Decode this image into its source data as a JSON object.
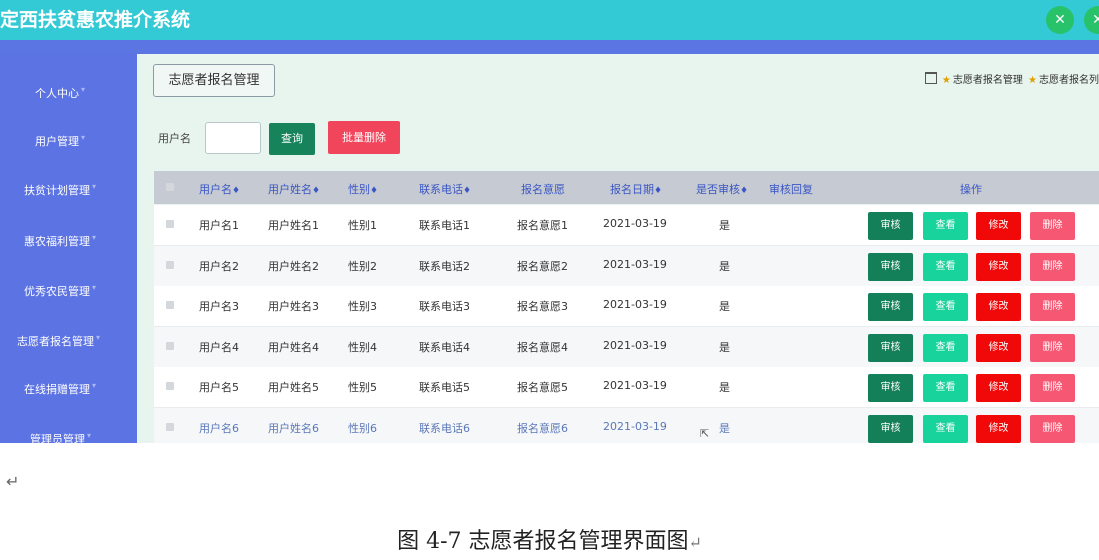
{
  "app_title": "定西扶贫惠农推介系统",
  "colors": {
    "topbar": "#33c9d5",
    "sidebar": "#5c73e3",
    "accent_green": "#16835a",
    "danger": "#f1455b"
  },
  "top_icons": [
    "expand-icon",
    "user-icon"
  ],
  "sidebar": {
    "items": [
      {
        "label": "个人中心"
      },
      {
        "label": "用户管理"
      },
      {
        "label": "扶贫计划管理"
      },
      {
        "label": "惠农福利管理"
      },
      {
        "label": "优秀农民管理"
      },
      {
        "label": "志愿者报名管理"
      },
      {
        "label": "在线捐赠管理"
      },
      {
        "label": "管理员管理"
      }
    ]
  },
  "page": {
    "section_button": "志愿者报名管理",
    "breadcrumb": {
      "first": "志愿者报名管理",
      "second": "志愿者报名列"
    }
  },
  "search": {
    "label": "用户名",
    "value": "",
    "query_button": "查询",
    "batch_delete_button": "批量删除"
  },
  "table": {
    "columns": {
      "username": "用户名",
      "realname": "用户姓名",
      "gender": "性别",
      "phone": "联系电话",
      "intention": "报名意愿",
      "date": "报名日期",
      "audited": "是否审核",
      "reply": "审核回复",
      "actions": "操作"
    },
    "sort_glyph": "♦",
    "actions": {
      "review": "审核",
      "view": "查看",
      "edit": "修改",
      "delete": "删除"
    },
    "rows": [
      {
        "username": "用户名1",
        "realname": "用户姓名1",
        "gender": "性别1",
        "phone": "联系电话1",
        "intention": "报名意愿1",
        "date": "2021-03-19",
        "audited": "是",
        "reply": ""
      },
      {
        "username": "用户名2",
        "realname": "用户姓名2",
        "gender": "性别2",
        "phone": "联系电话2",
        "intention": "报名意愿2",
        "date": "2021-03-19",
        "audited": "是",
        "reply": ""
      },
      {
        "username": "用户名3",
        "realname": "用户姓名3",
        "gender": "性别3",
        "phone": "联系电话3",
        "intention": "报名意愿3",
        "date": "2021-03-19",
        "audited": "是",
        "reply": ""
      },
      {
        "username": "用户名4",
        "realname": "用户姓名4",
        "gender": "性别4",
        "phone": "联系电话4",
        "intention": "报名意愿4",
        "date": "2021-03-19",
        "audited": "是",
        "reply": ""
      },
      {
        "username": "用户名5",
        "realname": "用户姓名5",
        "gender": "性别5",
        "phone": "联系电话5",
        "intention": "报名意愿5",
        "date": "2021-03-19",
        "audited": "是",
        "reply": ""
      },
      {
        "username": "用户名6",
        "realname": "用户姓名6",
        "gender": "性别6",
        "phone": "联系电话6",
        "intention": "报名意愿6",
        "date": "2021-03-19",
        "audited": "是",
        "reply": ""
      }
    ]
  },
  "document": {
    "paragraph_mark": "↵",
    "caption": "图 4-7 志愿者报名管理界面图"
  }
}
